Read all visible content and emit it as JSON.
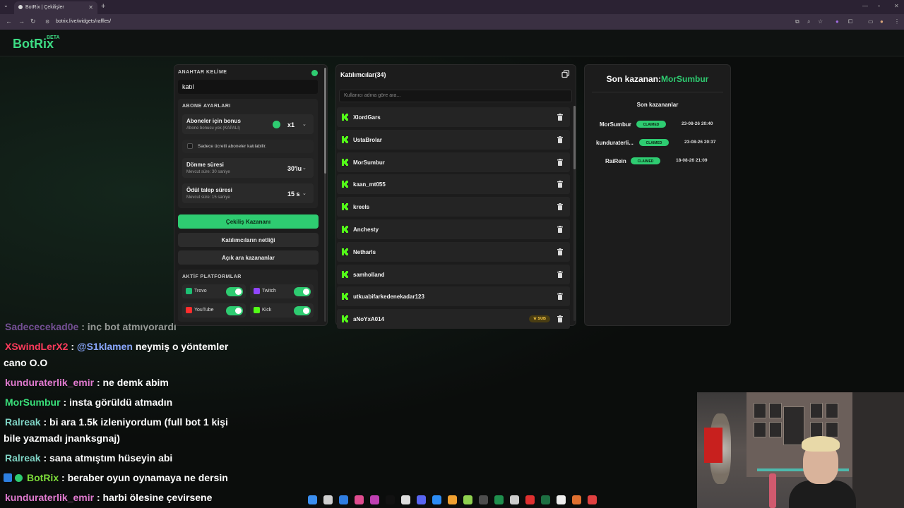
{
  "browser": {
    "tab_title": "BotRix | Çekilişler",
    "url": "botrix.live/widgets/raffles/"
  },
  "site": {
    "logo": "BotRix",
    "beta": "BETA"
  },
  "settings": {
    "keyword_label": "ANAHTAR KELİME",
    "keyword_value": "katıl",
    "sub_section_label": "ABONE AYARLARI",
    "sub_bonus_title": "Aboneler için bonus",
    "sub_bonus_desc": "Abone bonusu yok (KAPALI)",
    "sub_bonus_value": "x1",
    "paid_only_label": "Sadece ücretli aboneler katılabilir.",
    "spin_title": "Dönme süresi",
    "spin_desc": "Mevcut süre: 30 saniye",
    "spin_value": "30'lu",
    "claim_title": "Ödül talep süresi",
    "claim_desc": "Mevcut süre: 15 saniye",
    "claim_value": "15 s",
    "btn_draw": "Çekiliş Kazananı",
    "btn_clear": "Katılımcıların netliği",
    "btn_open_winners": "Açık ara kazananlar",
    "platforms_label": "AKTİF PLATFORMLAR",
    "platforms": [
      {
        "name": "Trovo",
        "color": "#1dbf73",
        "enabled": true
      },
      {
        "name": "Twitch",
        "color": "#9146ff",
        "enabled": true
      },
      {
        "name": "YouTube",
        "color": "#ff2d2d",
        "enabled": true
      },
      {
        "name": "Kick",
        "color": "#53fc18",
        "enabled": true
      }
    ]
  },
  "participants": {
    "title": "Katılımcılar(34)",
    "search_placeholder": "Kullanıcı adına göre ara...",
    "list": [
      {
        "name": "XlordGars"
      },
      {
        "name": "UstaBrolar"
      },
      {
        "name": "MorSumbur"
      },
      {
        "name": "kaan_mt055"
      },
      {
        "name": "kreels"
      },
      {
        "name": "Anchesty"
      },
      {
        "name": "Netharls"
      },
      {
        "name": "samholland"
      },
      {
        "name": "utkuabifarkedenekadar123"
      },
      {
        "name": "aNoYxA014",
        "badge": "SUB"
      }
    ]
  },
  "winners": {
    "last_winner_prefix": "Son kazanan:",
    "last_winner_name": "MorSumbur",
    "recent_title": "Son kazananlar",
    "list": [
      {
        "name": "MorSumbur",
        "status": "CLAIMED",
        "date": "23-08-26 20:40"
      },
      {
        "name": "kunduraterli...",
        "status": "CLAIMED",
        "date": "23-08-26 20:37"
      },
      {
        "name": "RaiRein",
        "status": "CLAIMED",
        "date": "18-08-26 21:09"
      }
    ]
  },
  "chat": [
    {
      "user": "Sadececekad0e",
      "color": "#c77dff",
      "text": ": inç bot atmıyorardı"
    },
    {
      "user": "XSwindLerX2",
      "color": "#ff3b5c",
      "text": ": ",
      "mention": "@S1klamen",
      "rest": " neymiş o yöntemler"
    },
    {
      "cont": "cano O.O"
    },
    {
      "user": "kunduraterlik_emir",
      "color": "#e27bd0",
      "text": ": ne demk abim"
    },
    {
      "user": "MorSumbur",
      "color": "#39e07a",
      "text": ": insta görüldü atmadın"
    },
    {
      "user": "Ralreak",
      "color": "#7fd3c4",
      "text": ": bi ara 1.5k izleniyordum (full bot 1 kişi"
    },
    {
      "cont": "bile yazmadı jnanksgnaj)"
    },
    {
      "user": "Ralreak",
      "color": "#7fd3c4",
      "text": ": sana atmıştım hüseyin abi"
    },
    {
      "user": "BotRix",
      "color": "#7ddc3a",
      "text": ": beraber oyun oynamaya ne dersin"
    },
    {
      "user": "kunduraterlik_emir",
      "color": "#e27bd0",
      "text": ": harbi ölesine çevirsene"
    }
  ]
}
